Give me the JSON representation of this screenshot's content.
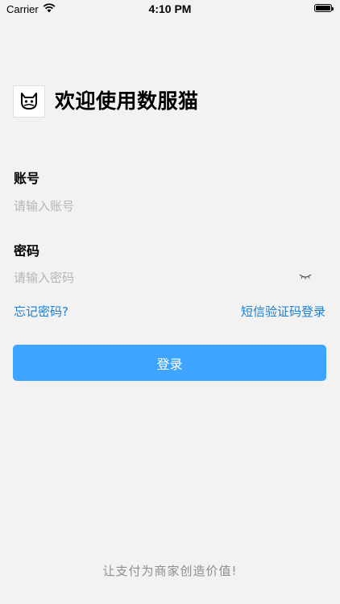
{
  "status_bar": {
    "carrier": "Carrier",
    "time": "4:10 PM"
  },
  "header": {
    "title": "欢迎使用数服猫",
    "logo_icon": "cat-logo-icon"
  },
  "form": {
    "account_label": "账号",
    "account_placeholder": "请输入账号",
    "password_label": "密码",
    "password_placeholder": "请输入密码",
    "password_toggle_icon": "eye-closed-icon",
    "forgot_password": "忘记密码?",
    "sms_login": "短信验证码登录",
    "login_button": "登录"
  },
  "footer": {
    "slogan": "让支付为商家创造价值!"
  },
  "colors": {
    "accent": "#3da5ff",
    "link": "#1a7fd4",
    "background": "#f2f2f2",
    "placeholder": "#b5b5b5"
  }
}
